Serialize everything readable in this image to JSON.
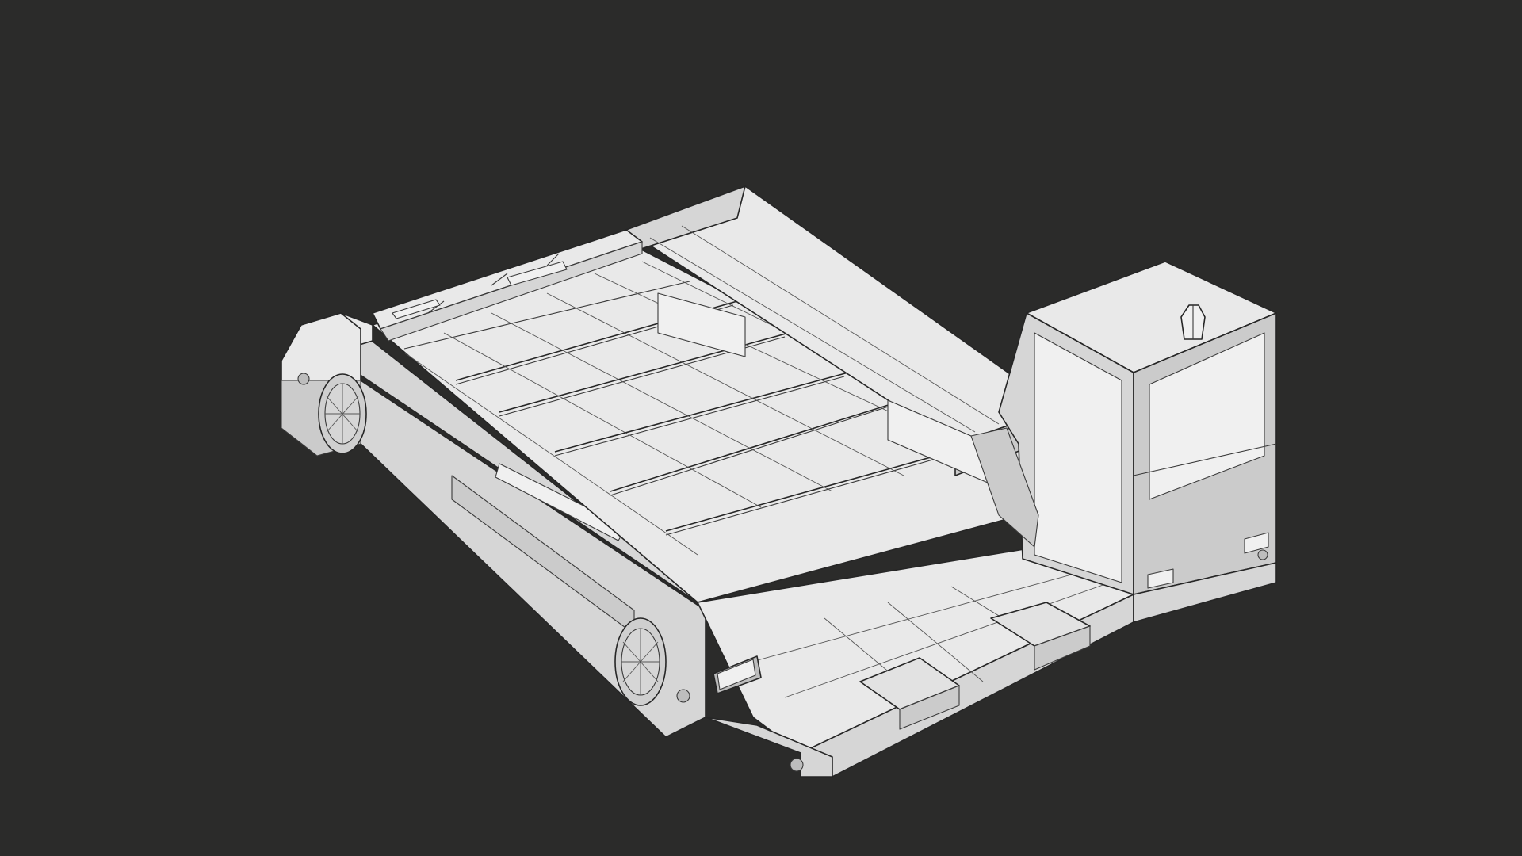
{
  "scene": {
    "background_color": "#2b2b2a",
    "surface_color": "#e6e6e6",
    "wire_color": "#3a3a3a",
    "render_mode": "wireframe-on-shaded"
  },
  "model": {
    "icon": "low-poly-flatbed-cart-icon",
    "parts": [
      "deck",
      "side-rails",
      "front-bumper",
      "wheels",
      "cab-box",
      "beacon-light",
      "step-plates"
    ]
  }
}
